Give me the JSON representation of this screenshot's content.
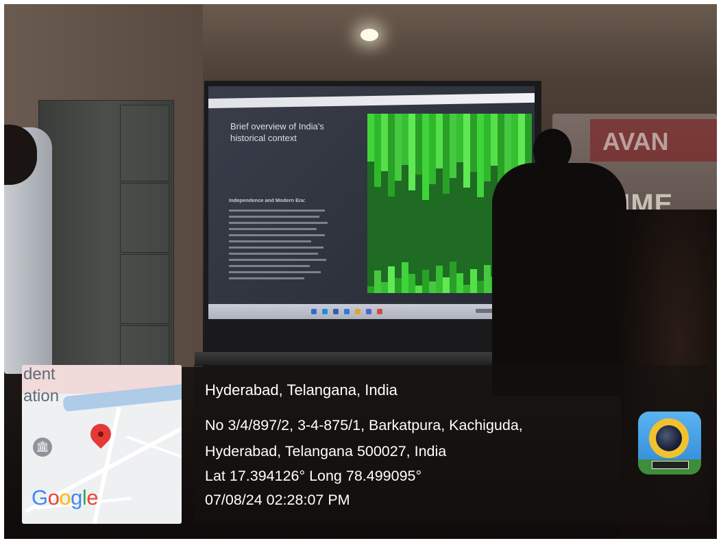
{
  "slide": {
    "title": "Brief overview of India's historical context",
    "heading": "Independence and Modern Era:"
  },
  "banner": {
    "brand": "AVAN",
    "word": "MME"
  },
  "map": {
    "label_1": "dent",
    "label_2": "ation",
    "logo": "Google",
    "colors": {
      "pin": "#e53935",
      "water": "#aecbe8"
    }
  },
  "location": {
    "city": "Hyderabad, Telangana, India",
    "address_line_1": "No 3/4/897/2, 3-4-875/1, Barkatpura, Kachiguda,",
    "address_line_2": "Hyderabad, Telangana 500027, India",
    "coordinates": "Lat 17.394126° Long 78.499095°",
    "timestamp": "07/08/24 02:28:07 PM"
  },
  "icons": {
    "museum": "museum-icon",
    "pin": "map-pin-icon",
    "app": "gps-camera-app-icon"
  }
}
